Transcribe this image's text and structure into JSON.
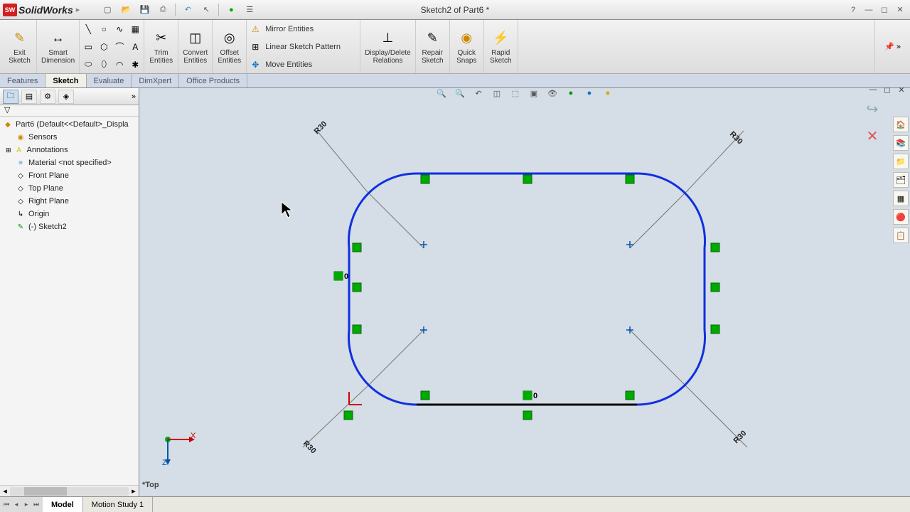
{
  "appName": "SolidWorks",
  "docTitle": "Sketch2 of Part6 *",
  "qat": {
    "help": "?"
  },
  "ribbon": {
    "exitSketch": "Exit\nSketch",
    "smartDim": "Smart\nDimension",
    "trim": "Trim\nEntities",
    "convert": "Convert\nEntities",
    "offset": "Offset\nEntities",
    "mirror": "Mirror Entities",
    "linear": "Linear Sketch Pattern",
    "move": "Move Entities",
    "displayDelete": "Display/Delete\nRelations",
    "repair": "Repair\nSketch",
    "quick": "Quick\nSnaps",
    "rapid": "Rapid\nSketch"
  },
  "tabs": {
    "features": "Features",
    "sketch": "Sketch",
    "evaluate": "Evaluate",
    "dimxpert": "DimXpert",
    "office": "Office Products"
  },
  "tree": {
    "root": "Part6  (Default<<Default>_Displa",
    "sensors": "Sensors",
    "annotations": "Annotations",
    "material": "Material <not specified>",
    "front": "Front Plane",
    "top": "Top Plane",
    "right": "Right Plane",
    "origin": "Origin",
    "sketch": "(-) Sketch2"
  },
  "dims": {
    "r1": "R30",
    "r2": "R30",
    "r3": "R30",
    "r4": "R30"
  },
  "viewLabel": "*Top",
  "triadX": "X",
  "triadZ": "Z",
  "bottomTabs": {
    "model": "Model",
    "motion": "Motion Study 1"
  },
  "coincLabel": "0"
}
